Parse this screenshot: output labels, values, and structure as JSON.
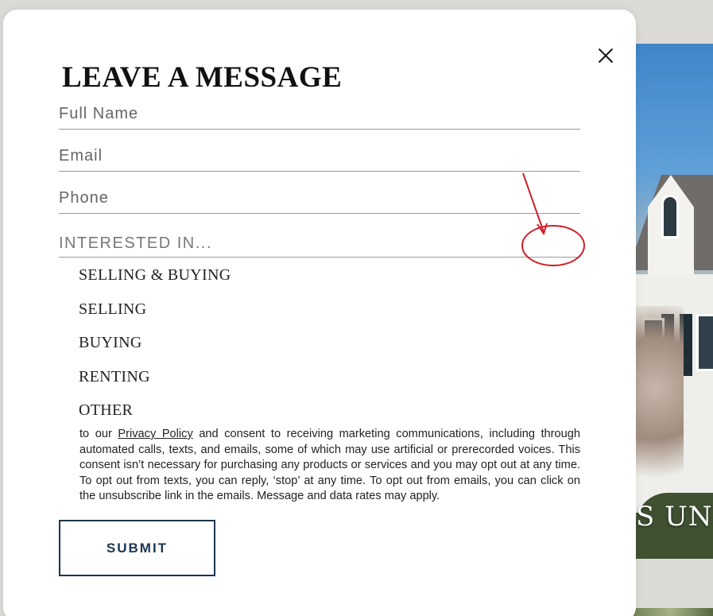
{
  "hero": {
    "caption": "S UNI"
  },
  "modal": {
    "title": "LEAVE A MESSAGE",
    "close_icon": "close-icon",
    "fields": {
      "full_name": {
        "placeholder": "Full Name",
        "value": ""
      },
      "email": {
        "placeholder": "Email",
        "value": ""
      },
      "phone": {
        "placeholder": "Phone",
        "value": ""
      }
    },
    "interested": {
      "label": "INTERESTED IN...",
      "options": [
        "SELLING & BUYING",
        "SELLING",
        "BUYING",
        "RENTING",
        "OTHER"
      ]
    },
    "consent": {
      "prefix": "to our ",
      "link": "Privacy Policy",
      "suffix": " and consent to receiving marketing communications, including through automated calls, texts, and emails, some of which may use artificial or prerecorded voices. This consent isn’t necessary for purchasing any products or services and you may opt out at any time. To opt out from texts, you can reply, ‘stop’ at any time. To opt out from emails, you can click on the unsubscribe link in the emails. Message and data rates may apply."
    },
    "submit_label": "SUBMIT"
  },
  "colors": {
    "annotation": "#d0202a",
    "button_border": "#1b3550"
  }
}
